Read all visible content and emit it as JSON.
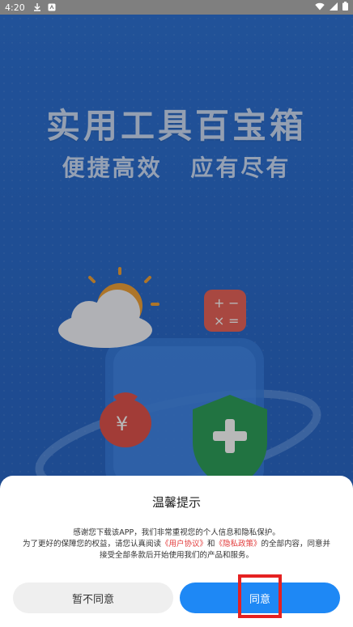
{
  "status_bar": {
    "time": "4:20"
  },
  "hero": {
    "title": "实用工具百宝箱",
    "subtitle": "便捷高效 应有尽有"
  },
  "dialog": {
    "title": "温馨提示",
    "body_line1": "感谢您下载该APP，我们非常重视您的个人信息和隐私保护。",
    "body_line2_prefix": "为了更好的保障您的权益，请您认真阅读",
    "user_agreement_link": "《用户协议》",
    "and_text": "和",
    "privacy_policy_link": "《隐私政策》",
    "body_line2_suffix": "的全部内容，同意并",
    "body_line3": "接受全部条款后开始使用我们的产品和服务。",
    "decline_label": "暂不同意",
    "agree_label": "同意"
  },
  "colors": {
    "hero_blue": "#2e72d4",
    "agree_blue": "#1e88f5",
    "link_red": "#e23b3b",
    "highlight_red": "#e52121"
  }
}
